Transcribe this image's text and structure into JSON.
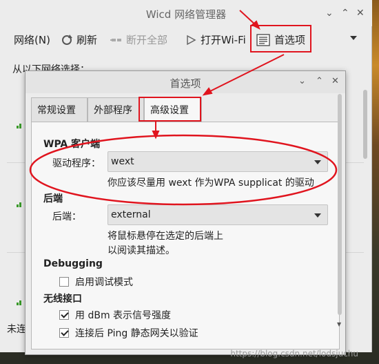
{
  "main_window": {
    "title": "Wicd 网络管理器",
    "toolbar": {
      "network": "网络(N)",
      "refresh": "刷新",
      "disconnect_all": "断开全部",
      "open_wifi": "打开Wi-Fi",
      "preferences": "首选项"
    },
    "choose_label": "从以下网络选择：",
    "status": "未连"
  },
  "dialog": {
    "title": "首选项",
    "tabs": [
      "常规设置",
      "外部程序",
      "高级设置"
    ],
    "active_tab": "高级设置",
    "wpa_section": "WPA 客户端",
    "driver_label": "驱动程序：",
    "driver_value": "wext",
    "driver_hint": "你应该尽量用 wext 作为WPA supplicat 的驱动",
    "backend_section": "后端",
    "backend_label": "后端：",
    "backend_value": "external",
    "backend_hint_1": "将鼠标悬停在选定的后端上",
    "backend_hint_2": "以阅读其描述。",
    "debugging_section": "Debugging",
    "debug_mode": "启用调试模式",
    "debug_checked": false,
    "wireless_section": "无线接口",
    "use_dbm": "用 dBm 表示信号强度",
    "use_dbm_checked": true,
    "ping_gateway": "连接后 Ping 静态网关以验证",
    "ping_gateway_checked": true
  },
  "watermark": "https://blog.csdn.net/lodsjuchu",
  "colors": {
    "annotation_red": "#e0141e",
    "window_bg": "#ececec",
    "panel_bg": "#f7f7f7"
  }
}
